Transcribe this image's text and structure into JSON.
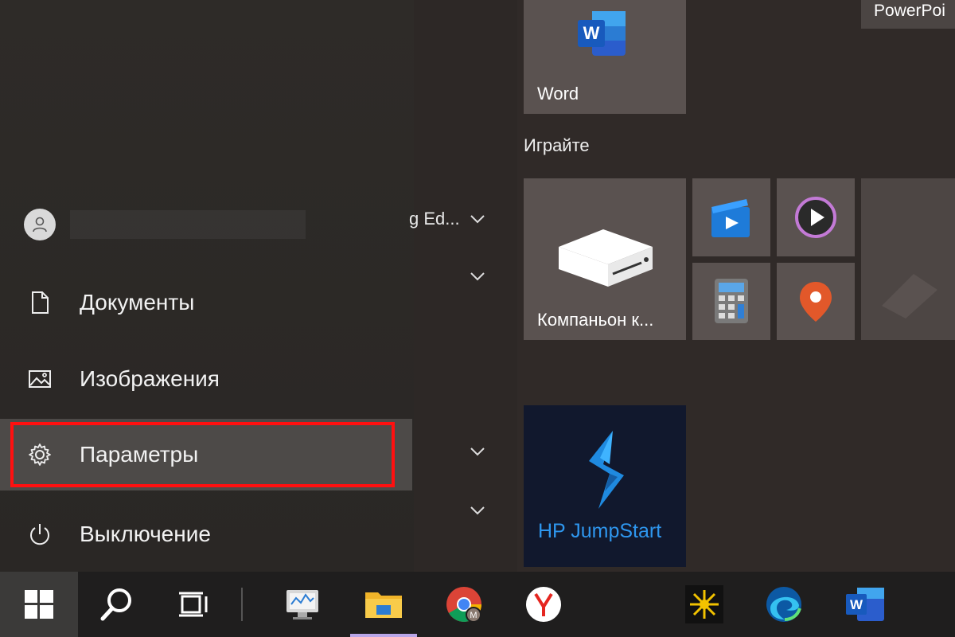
{
  "start_menu": {
    "user": {
      "name": ""
    },
    "items": [
      {
        "label": "Документы",
        "icon": "document-icon"
      },
      {
        "label": "Изображения",
        "icon": "pictures-icon"
      },
      {
        "label": "Параметры",
        "icon": "gear-icon"
      },
      {
        "label": "Выключение",
        "icon": "power-icon"
      }
    ]
  },
  "app_list": {
    "partial_label": "g Ed..."
  },
  "tiles": {
    "word_label": "Word",
    "powerpoint_label": "PowerPoi",
    "group_header": "Играйте",
    "companion_label": "Компаньон к...",
    "hp_label": "HP JumpStart"
  },
  "taskbar": {
    "items": [
      "start-button",
      "search-button",
      "task-view-button",
      "resource-monitor",
      "file-explorer",
      "chrome",
      "yandex-browser",
      "pinned-app",
      "edge",
      "word"
    ]
  },
  "colors": {
    "highlight": "#ff1010",
    "word_blue": "#2b5dcc",
    "hp_blue": "#1e7bd9",
    "accent": "#b9a6e8"
  }
}
